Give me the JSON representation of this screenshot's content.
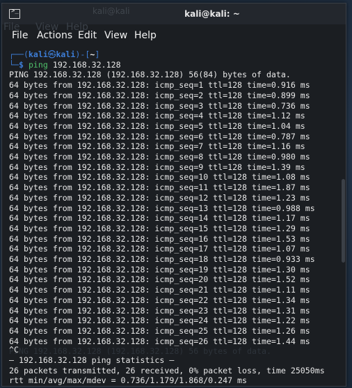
{
  "window": {
    "title": "kali@kali: ~",
    "ghost_title": "kali@kali"
  },
  "menubar": {
    "file": "File",
    "actions": "Actions",
    "edit": "Edit",
    "view": "View",
    "help": "Help",
    "ghost_items": [
      "File",
      "View",
      "Help"
    ]
  },
  "prompt": {
    "open_bracket": "┌──(",
    "user": "kali",
    "skull": "㉿",
    "host": "kali",
    "close_bracket": ")-[",
    "path": "~",
    "end_bracket": "]",
    "second_line_prefix": "└─",
    "dollar": "$ ",
    "command": "ping",
    "argument": " 192.168.32.128"
  },
  "output": {
    "header": "PING 192.168.32.128 (192.168.32.128) 56(84) bytes of data.",
    "replies": [
      "64 bytes from 192.168.32.128: icmp_seq=1 ttl=128 time=0.916 ms",
      "64 bytes from 192.168.32.128: icmp_seq=2 ttl=128 time=0.899 ms",
      "64 bytes from 192.168.32.128: icmp_seq=3 ttl=128 time=0.736 ms",
      "64 bytes from 192.168.32.128: icmp_seq=4 ttl=128 time=1.12 ms",
      "64 bytes from 192.168.32.128: icmp_seq=5 ttl=128 time=1.04 ms",
      "64 bytes from 192.168.32.128: icmp_seq=6 ttl=128 time=0.787 ms",
      "64 bytes from 192.168.32.128: icmp_seq=7 ttl=128 time=1.16 ms",
      "64 bytes from 192.168.32.128: icmp_seq=8 ttl=128 time=0.980 ms",
      "64 bytes from 192.168.32.128: icmp_seq=9 ttl=128 time=1.39 ms",
      "64 bytes from 192.168.32.128: icmp_seq=10 ttl=128 time=1.08 ms",
      "64 bytes from 192.168.32.128: icmp_seq=11 ttl=128 time=1.87 ms",
      "64 bytes from 192.168.32.128: icmp_seq=12 ttl=128 time=1.23 ms",
      "64 bytes from 192.168.32.128: icmp_seq=13 ttl=128 time=0.988 ms",
      "64 bytes from 192.168.32.128: icmp_seq=14 ttl=128 time=1.17 ms",
      "64 bytes from 192.168.32.128: icmp_seq=15 ttl=128 time=1.29 ms",
      "64 bytes from 192.168.32.128: icmp_seq=16 ttl=128 time=1.53 ms",
      "64 bytes from 192.168.32.128: icmp_seq=17 ttl=128 time=1.07 ms",
      "64 bytes from 192.168.32.128: icmp_seq=18 ttl=128 time=0.933 ms",
      "64 bytes from 192.168.32.128: icmp_seq=19 ttl=128 time=1.30 ms",
      "64 bytes from 192.168.32.128: icmp_seq=20 ttl=128 time=1.52 ms",
      "64 bytes from 192.168.32.128: icmp_seq=21 ttl=128 time=1.11 ms",
      "64 bytes from 192.168.32.128: icmp_seq=22 ttl=128 time=1.34 ms",
      "64 bytes from 192.168.32.128: icmp_seq=23 ttl=128 time=1.31 ms",
      "64 bytes from 192.168.32.128: icmp_seq=24 ttl=128 time=1.22 ms",
      "64 bytes from 192.168.32.128: icmp_seq=25 ttl=128 time=1.26 ms",
      "64 bytes from 192.168.32.128: icmp_seq=26 ttl=128 time=1.44 ms"
    ],
    "interrupt": "^C",
    "ghost_behind_interrupt": "PING 192.168.32.128 (192.168.32.128) 56 bytes of data.",
    "stats_header": "— 192.168.32.128 ping statistics —",
    "stats_packets": "26 packets transmitted, 26 received, 0% packet loss, time 25050ms",
    "stats_rtt": "rtt min/avg/max/mdev = 0.736/1.179/1.868/0.247 ms"
  },
  "colors": {
    "prompt_blue": "#3d7dd6",
    "command_green": "#4fc06a",
    "terminal_bg": "#1b1e22",
    "text": "#e8e8e8"
  },
  "icons": {
    "app_icon": "terminal-icon"
  }
}
